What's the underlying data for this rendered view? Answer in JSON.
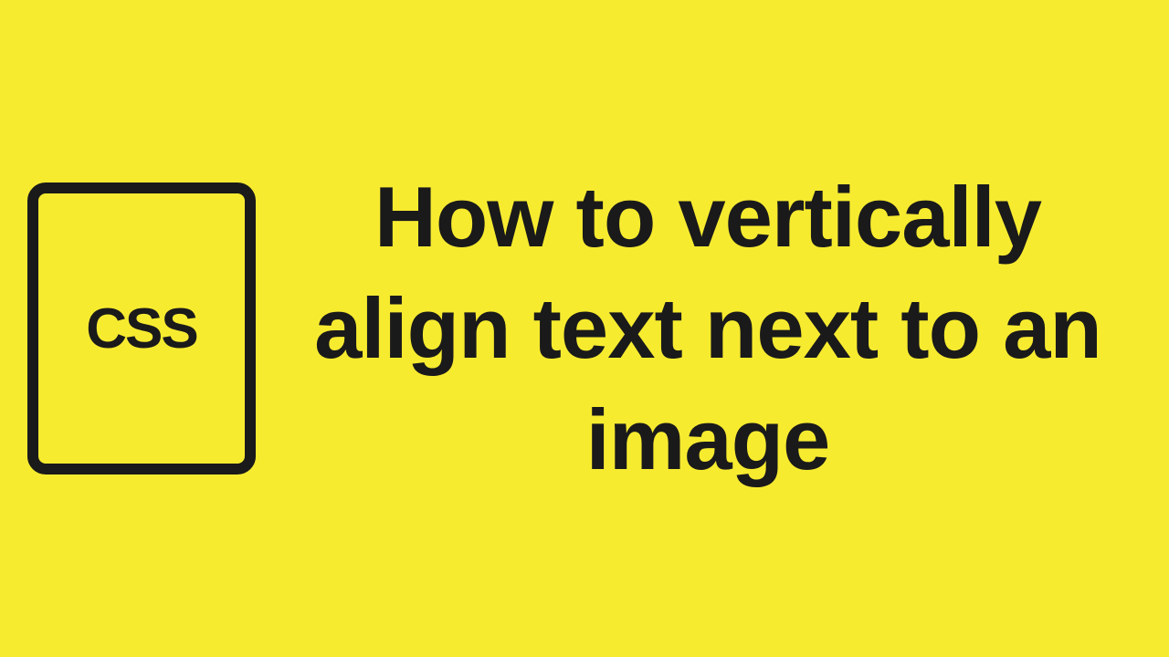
{
  "box": {
    "label": "CSS"
  },
  "title": {
    "text": "How to vertically align text next to an image"
  }
}
